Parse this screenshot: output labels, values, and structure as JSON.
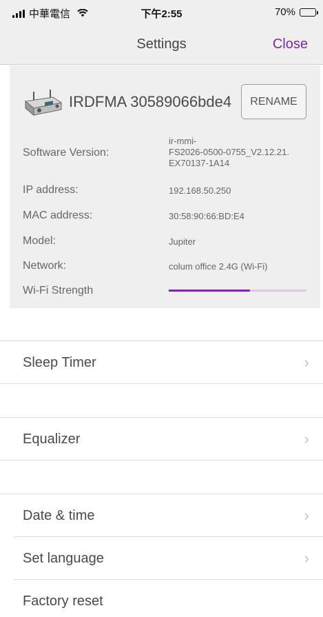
{
  "status_bar": {
    "carrier": "中華電信",
    "time": "下午2:55",
    "battery": "70%",
    "battery_level": 0.7
  },
  "nav": {
    "title": "Settings",
    "close_label": "Close"
  },
  "device": {
    "name": "IRDFMA 30589066bde4",
    "rename_label": "RENAME",
    "info": [
      {
        "label": "Software Version:",
        "value_lines": [
          "ir-mmi-",
          "FS2026-0500-0755_V2.12.21.",
          "EX70137-1A14"
        ]
      },
      {
        "label": "IP address:",
        "value": "192.168.50.250"
      },
      {
        "label": "MAC address:",
        "value": "30:58:90:66:BD:E4"
      },
      {
        "label": "Model:",
        "value": "Jupiter"
      },
      {
        "label": "Network:",
        "value": "colum office 2.4G (Wi-Fi)"
      }
    ],
    "wifi_label": "Wi-Fi Strength",
    "wifi_strength": 0.59
  },
  "menu": [
    {
      "label": "Sleep Timer",
      "chevron": "chevron-right-icon"
    },
    {
      "label": "Equalizer",
      "chevron": "chevron-right-icon"
    },
    {
      "label": "Date & time",
      "chevron": "chevron-right-icon"
    },
    {
      "label": "Set language",
      "chevron": "chevron-right-icon"
    },
    {
      "label": "Factory reset"
    }
  ],
  "colors": {
    "accent": "#7a2a9a",
    "wifi_track": "#ddc6e6",
    "panel_bg": "#efefef"
  }
}
